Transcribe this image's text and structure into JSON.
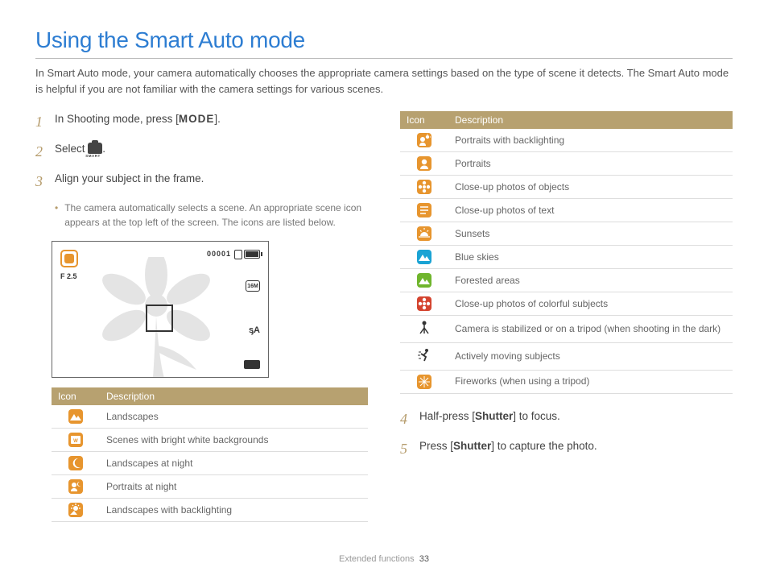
{
  "title": "Using the Smart Auto mode",
  "intro": "In Smart Auto mode, your camera automatically chooses the appropriate camera settings based on the type of scene it detects. The Smart Auto mode is helpful if you are not familiar with the camera settings for various scenes.",
  "steps": {
    "s1_a": "In Shooting mode, press [",
    "s1_mode": "MODE",
    "s1_b": "].",
    "s2_a": "Select ",
    "s2_b": ".",
    "s3": "Align your subject in the frame.",
    "s3_sub": "The camera automatically selects a scene. An appropriate scene icon appears at the top left of the screen. The icons are listed below.",
    "s4_a": "Half-press [",
    "s4_bold": "Shutter",
    "s4_b": "] to focus.",
    "s5_a": "Press [",
    "s5_bold": "Shutter",
    "s5_b": "] to capture the photo."
  },
  "screen": {
    "f": "F 2.5",
    "counter": "00001",
    "size": "16M",
    "flash": "ᶊA",
    "bar": "▬"
  },
  "table_headers": {
    "icon": "Icon",
    "desc": "Description"
  },
  "table1": [
    {
      "color": "#e7952e",
      "glyph": "mountain",
      "desc": "Landscapes"
    },
    {
      "color": "#e7952e",
      "glyph": "white",
      "desc": "Scenes with bright white backgrounds"
    },
    {
      "color": "#e7952e",
      "glyph": "moon",
      "desc": "Landscapes at night"
    },
    {
      "color": "#e7952e",
      "glyph": "portrait-night",
      "desc": "Portraits at night"
    },
    {
      "color": "#e7952e",
      "glyph": "backlight",
      "desc": "Landscapes with backlighting"
    }
  ],
  "table2": [
    {
      "color": "#e7952e",
      "glyph": "portrait-backlight",
      "desc": "Portraits with backlighting"
    },
    {
      "color": "#e7952e",
      "glyph": "portrait",
      "desc": "Portraits"
    },
    {
      "color": "#e7952e",
      "glyph": "flower",
      "desc": "Close-up photos of objects"
    },
    {
      "color": "#e7952e",
      "glyph": "text",
      "desc": "Close-up photos of text"
    },
    {
      "color": "#e7952e",
      "glyph": "sunset",
      "desc": "Sunsets"
    },
    {
      "color": "#1aa3d4",
      "glyph": "mountain",
      "desc": "Blue skies"
    },
    {
      "color": "#6fb52c",
      "glyph": "mountain",
      "desc": "Forested areas"
    },
    {
      "color": "#d4432e",
      "glyph": "flower",
      "desc": "Close-up photos of colorful subjects"
    },
    {
      "bw": true,
      "glyph": "tripod",
      "desc": "Camera is stabilized or on a tripod (when shooting in the dark)"
    },
    {
      "bw": true,
      "glyph": "motion",
      "desc": "Actively moving subjects"
    },
    {
      "color": "#e7952e",
      "glyph": "fireworks",
      "desc": "Fireworks (when using a tripod)"
    }
  ],
  "footer": {
    "section": "Extended functions",
    "page": "33"
  }
}
